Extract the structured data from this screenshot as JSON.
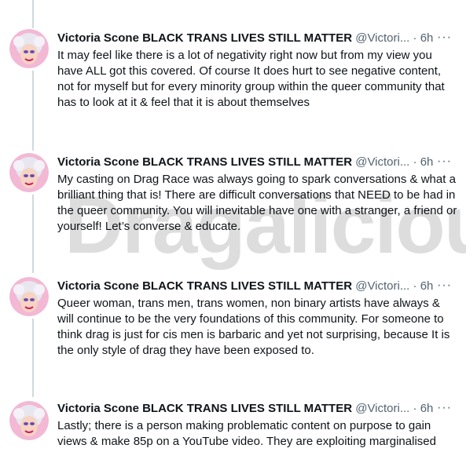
{
  "watermark": "Dragalicious",
  "tweets": [
    {
      "name": "Victoria Scone BLACK TRANS LIVES STILL MATTER",
      "handle": "@Victori...",
      "sep": "·",
      "time": "6h",
      "more": "···",
      "text": "It may feel like there is a lot of negativity right now but from my view you have ALL got this covered. Of course It does hurt to see negative content, not for myself but for every minority group within the queer community that has to look at it & feel that it is about themselves"
    },
    {
      "name": "Victoria Scone BLACK TRANS LIVES STILL MATTER",
      "handle": "@Victori...",
      "sep": "·",
      "time": "6h",
      "more": "···",
      "text": "My casting on Drag Race was always going to spark conversations & what a brilliant thing that is! There are difficult conversations that NEED to be had in the queer community. You will inevitable have one with a stranger, a friend or yourself! Let’s converse & educate."
    },
    {
      "name": "Victoria Scone BLACK TRANS LIVES STILL MATTER",
      "handle": "@Victori...",
      "sep": "·",
      "time": "6h",
      "more": "···",
      "text": "Queer woman, trans men, trans women, non binary artists have always & will continue to be the very foundations of this community. For someone to think drag is just for cis men is barbaric and yet not surprising, because It is the only style of drag they have been exposed to."
    },
    {
      "name": "Victoria Scone BLACK TRANS LIVES STILL MATTER",
      "handle": "@Victori...",
      "sep": "·",
      "time": "6h",
      "more": "···",
      "text": "Lastly; there is a person making problematic content on purpose to gain views & make 85p on a YouTube video. They are exploiting marginalised"
    }
  ]
}
